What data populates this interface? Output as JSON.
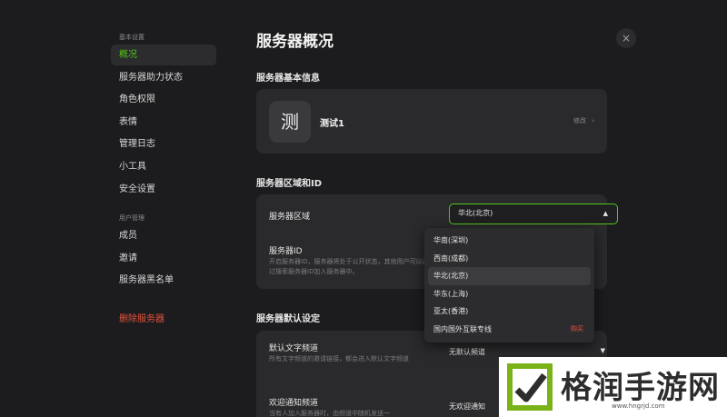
{
  "sidebar": {
    "group_basic": "基本设置",
    "items_basic": [
      "概况",
      "服务器助力状态",
      "角色权限",
      "表情",
      "管理日志",
      "小工具",
      "安全设置"
    ],
    "group_users": "用户管理",
    "items_users": [
      "成员",
      "邀请",
      "服务器黑名单"
    ],
    "delete_label": "删除服务器",
    "active_item": "概况"
  },
  "main": {
    "title": "服务器概况",
    "close_icon": "×",
    "basic_info": {
      "section_title": "服务器基本信息",
      "avatar_char": "测",
      "server_name": "测试1",
      "edit_label": "修改",
      "edit_chevron": "›"
    },
    "region": {
      "section_title": "服务器区域和ID",
      "region_label": "服务器区域",
      "selected_value": "华北(北京)",
      "caret_up": "▲",
      "id_label": "服务器ID",
      "id_desc": "开启服务器ID，服务器将处于公开状态，其他用户可以通过搜索服务器ID加入服务器中。",
      "options": [
        {
          "label": "华南(深圳)",
          "badge": ""
        },
        {
          "label": "西南(成都)",
          "badge": ""
        },
        {
          "label": "华北(北京)",
          "badge": ""
        },
        {
          "label": "华东(上海)",
          "badge": ""
        },
        {
          "label": "亚太(香港)",
          "badge": ""
        },
        {
          "label": "国内国外互联专线",
          "badge": "购买"
        }
      ],
      "selected_index": 2
    },
    "defaults": {
      "section_title": "服务器默认设定",
      "default_channel_label": "默认文字频道",
      "default_channel_desc": "所有文字频道的邀请链接，都会进入默认文字频道",
      "default_channel_value": "无默认频道",
      "caret_down": "▼",
      "welcome_label": "欢迎通知频道",
      "welcome_desc": "当有人加入服务器时，由频道中随机发送一",
      "welcome_value": "无欢迎通知"
    }
  },
  "watermark": {
    "text": "格润手游网",
    "url": "www.hngrjd.com",
    "colors": {
      "green": "#7ab317",
      "dark": "#2d2d2d"
    }
  },
  "colors": {
    "accent": "#52c41a",
    "danger": "#e5533d",
    "background": "#1c1c1e",
    "card": "#2a2a2c"
  }
}
